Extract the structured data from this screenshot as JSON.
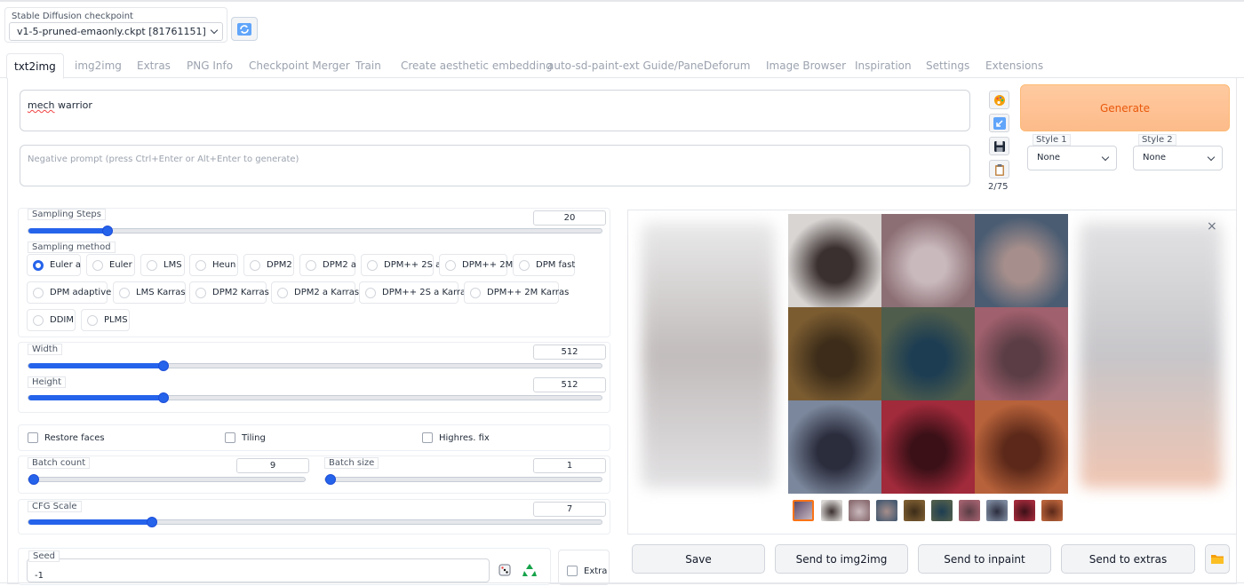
{
  "checkpoint": {
    "label": "Stable Diffusion checkpoint",
    "value": "v1-5-pruned-emaonly.ckpt [81761151]",
    "refresh_icon": "refresh-icon"
  },
  "tabs": [
    {
      "label": "txt2img",
      "active": true
    },
    {
      "label": "img2img"
    },
    {
      "label": "Extras"
    },
    {
      "label": "PNG Info"
    },
    {
      "label": "Checkpoint Merger"
    },
    {
      "label": "Train"
    },
    {
      "label": "Create aesthetic embedding"
    },
    {
      "label": "auto-sd-paint-ext Guide/Panel"
    },
    {
      "label": "Deforum"
    },
    {
      "label": "Image Browser"
    },
    {
      "label": "Inspiration"
    },
    {
      "label": "Settings"
    },
    {
      "label": "Extensions"
    }
  ],
  "prompt": {
    "word1": "mech",
    "word2": " warrior"
  },
  "negative_prompt": {
    "placeholder": "Negative prompt (press Ctrl+Enter or Alt+Enter to generate)"
  },
  "tools": {
    "token_count": "2/75",
    "icons": [
      "palette-icon",
      "arrow-icon",
      "save-disk-icon",
      "clipboard-icon"
    ]
  },
  "generate": {
    "label": "Generate",
    "color": "#fdbb8a"
  },
  "styles": [
    {
      "label": "Style 1",
      "value": "None"
    },
    {
      "label": "Style 2",
      "value": "None"
    }
  ],
  "sampling_steps": {
    "label": "Sampling Steps",
    "value": "20",
    "fraction": 0.13
  },
  "sampling_method": {
    "label": "Sampling method",
    "options": [
      "Euler a",
      "Euler",
      "LMS",
      "Heun",
      "DPM2",
      "DPM2 a",
      "DPM++ 2S a",
      "DPM++ 2M",
      "DPM fast",
      "DPM adaptive",
      "LMS Karras",
      "DPM2 Karras",
      "DPM2 a Karras",
      "DPM++ 2S a Karras",
      "DPM++ 2M Karras",
      "DDIM",
      "PLMS"
    ],
    "selected": "Euler a"
  },
  "width": {
    "label": "Width",
    "value": "512",
    "fraction": 0.23
  },
  "height": {
    "label": "Height",
    "value": "512",
    "fraction": 0.23
  },
  "checks": {
    "restore_faces": "Restore faces",
    "tiling": "Tiling",
    "highres": "Highres. fix"
  },
  "batch_count": {
    "label": "Batch count",
    "value": "9",
    "fraction": 0.0
  },
  "batch_size": {
    "label": "Batch size",
    "value": "1",
    "fraction": 0.0
  },
  "cfg_scale": {
    "label": "CFG Scale",
    "value": "7",
    "fraction": 0.21
  },
  "seed": {
    "label": "Seed",
    "value": "-1",
    "extra_label": "Extra",
    "icons": [
      "dice-icon",
      "recycle-icon"
    ]
  },
  "actions": {
    "save": "Save",
    "send_img2img": "Send to img2img",
    "send_inpaint": "Send to inpaint",
    "send_extras": "Send to extras",
    "folder_icon": "folder-icon"
  },
  "gallery": {
    "close_icon": "×",
    "images": [
      {
        "name": "spiky-creature",
        "colors": [
          "#d8d5d3",
          "#3b3030"
        ]
      },
      {
        "name": "white-robot-helmet",
        "colors": [
          "#8c6f74",
          "#c9b9bd"
        ]
      },
      {
        "name": "skeleton-mech",
        "colors": [
          "#4a5c72",
          "#a58e8b"
        ]
      },
      {
        "name": "golden-warrior",
        "colors": [
          "#7b5c31",
          "#3c2c19"
        ]
      },
      {
        "name": "blue-armored-mech",
        "colors": [
          "#4f5d4c",
          "#1d3d52"
        ]
      },
      {
        "name": "red-sunset-mech",
        "colors": [
          "#a0606d",
          "#5a3d45"
        ]
      },
      {
        "name": "dark-walker",
        "colors": [
          "#7b879c",
          "#2b2d3d"
        ]
      },
      {
        "name": "red-fox-warrior",
        "colors": [
          "#a12a3b",
          "#3b1017"
        ]
      },
      {
        "name": "orange-creature",
        "colors": [
          "#b7623a",
          "#5b2819"
        ]
      }
    ]
  }
}
